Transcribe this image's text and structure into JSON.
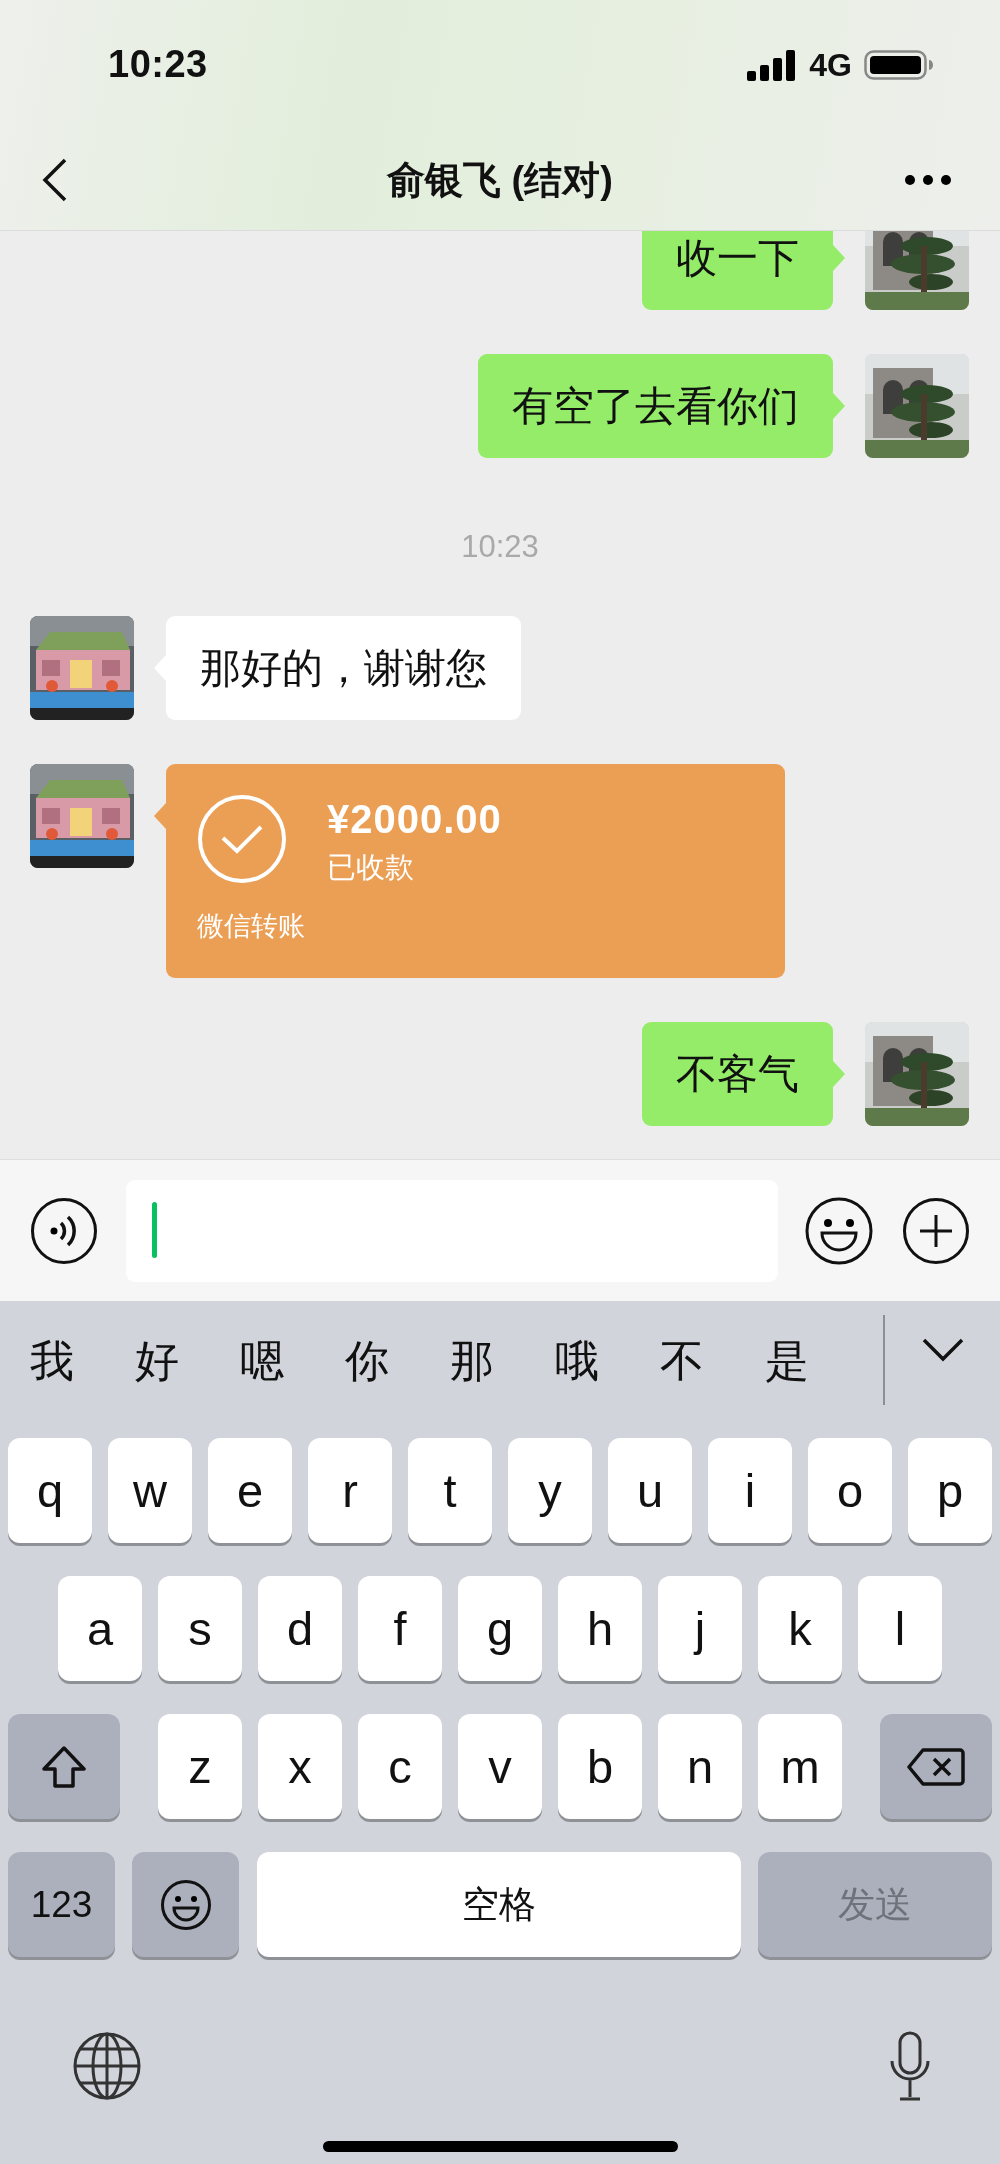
{
  "status_bar": {
    "time": "10:23",
    "network": "4G"
  },
  "nav": {
    "title": "俞银飞 (结对)"
  },
  "messages": [
    {
      "kind": "sent",
      "text": "收一下"
    },
    {
      "kind": "sent",
      "text": "有空了去看你们"
    },
    {
      "kind": "time",
      "text": "10:23"
    },
    {
      "kind": "received",
      "text": "那好的，谢谢您"
    },
    {
      "kind": "transfer",
      "amount": "¥2000.00",
      "status": "已收款",
      "footer": "微信转账"
    },
    {
      "kind": "sent",
      "text": "不客气"
    }
  ],
  "keyboard": {
    "candidates": [
      "我",
      "好",
      "嗯",
      "你",
      "那",
      "哦",
      "不",
      "是"
    ],
    "letter_rows": [
      [
        "q",
        "w",
        "e",
        "r",
        "t",
        "y",
        "u",
        "i",
        "o",
        "p"
      ],
      [
        "a",
        "s",
        "d",
        "f",
        "g",
        "h",
        "j",
        "k",
        "l"
      ],
      [
        "z",
        "x",
        "c",
        "v",
        "b",
        "n",
        "m"
      ]
    ],
    "numbers_key": "123",
    "space_key": "空格",
    "send_key": {
      "label": "发送",
      "disabled": true
    }
  }
}
